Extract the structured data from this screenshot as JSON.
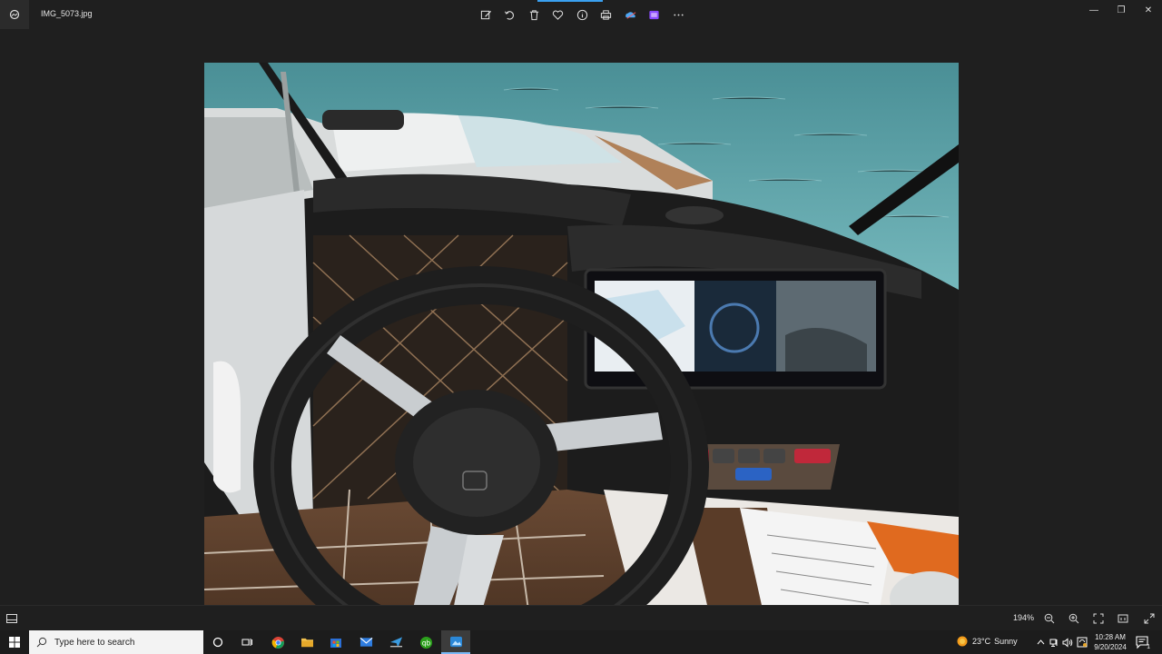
{
  "window": {
    "title": "IMG_5073.jpg"
  },
  "toolbar": {
    "buttons": [
      {
        "name": "edit-image-icon"
      },
      {
        "name": "rotate-icon"
      },
      {
        "name": "delete-icon"
      },
      {
        "name": "favorite-icon"
      },
      {
        "name": "info-icon"
      },
      {
        "name": "print-icon"
      },
      {
        "name": "onedrive-icon"
      },
      {
        "name": "clipchamp-icon"
      },
      {
        "name": "more-options-icon"
      }
    ]
  },
  "window_controls": {
    "minimize": "—",
    "maximize": "❐",
    "close": "✕"
  },
  "photo": {
    "subject": "boat-helm-steering-wheel-dashboard"
  },
  "bottombar": {
    "zoom_label": "194%"
  },
  "taskbar": {
    "search_placeholder": "Type here to search",
    "weather": {
      "temperature": "23°C",
      "condition": "Sunny"
    },
    "clock": {
      "time": "10:28 AM",
      "date": "9/20/2024"
    },
    "notifications_count": "1"
  },
  "colors": {
    "background": "#1f1f1f",
    "taskbar": "#1c1c1c",
    "accent": "#3aa0f0"
  }
}
